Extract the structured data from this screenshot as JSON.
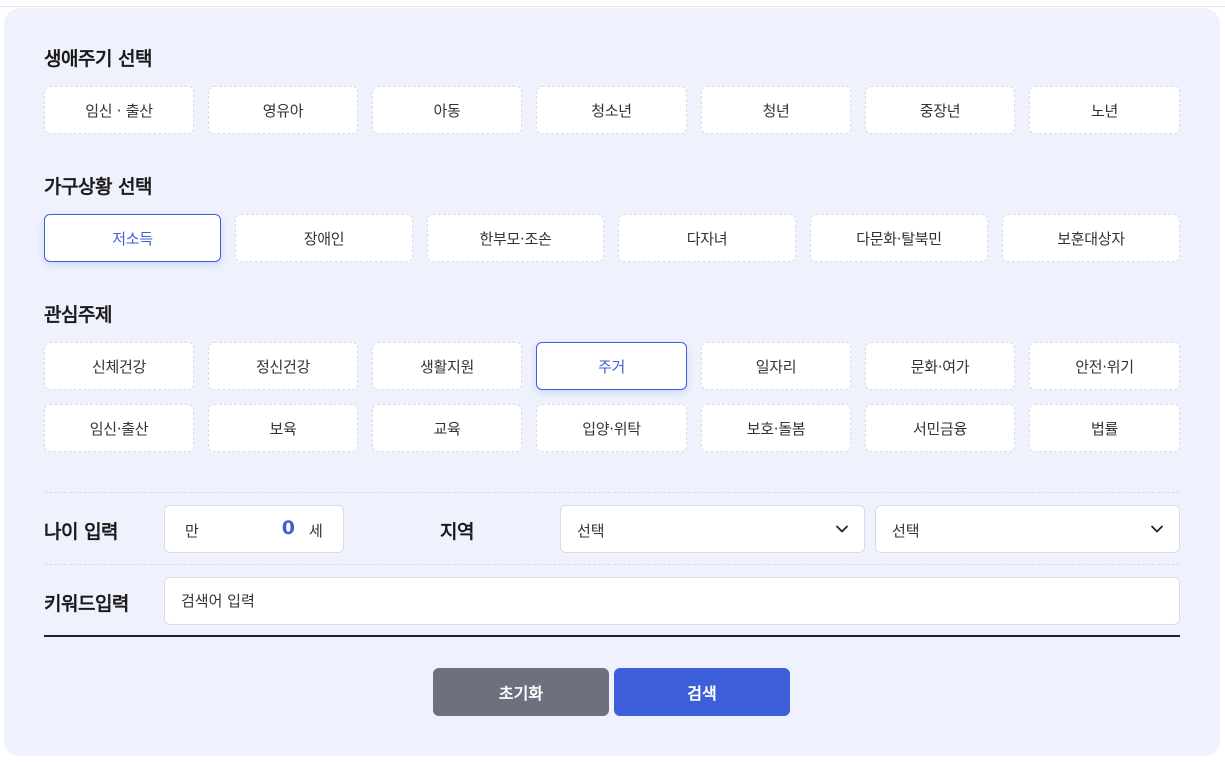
{
  "lifecycle": {
    "title": "생애주기 선택",
    "options": [
      "임신 · 출산",
      "영유아",
      "아동",
      "청소년",
      "청년",
      "중장년",
      "노년"
    ]
  },
  "household": {
    "title": "가구상황 선택",
    "options": [
      "저소득",
      "장애인",
      "한부모·조손",
      "다자녀",
      "다문화·탈북민",
      "보훈대상자"
    ],
    "selected": "저소득"
  },
  "interests": {
    "title": "관심주제",
    "row1": [
      "신체건강",
      "정신건강",
      "생활지원",
      "주거",
      "일자리",
      "문화·여가",
      "안전·위기"
    ],
    "row2": [
      "임신·출산",
      "보육",
      "교육",
      "입양·위탁",
      "보호·돌봄",
      "서민금융",
      "법률"
    ],
    "selected": "주거"
  },
  "age": {
    "label": "나이 입력",
    "prefix": "만",
    "value": "0",
    "suffix": "세"
  },
  "region": {
    "label": "지역",
    "select1": "선택",
    "select2": "선택"
  },
  "keyword": {
    "label": "키워드입력",
    "placeholder": "검색어 입력"
  },
  "buttons": {
    "reset": "초기화",
    "search": "검색"
  },
  "colors": {
    "accent": "#3d5fd9",
    "panel_bg": "#eff2fd",
    "reset_bg": "#6e7080"
  },
  "icons": {
    "select_arrow": "chevron-down-icon"
  }
}
